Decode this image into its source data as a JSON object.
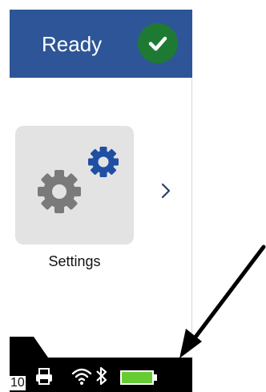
{
  "status": {
    "label": "Ready",
    "state_icon": "checkmark-icon",
    "bar_color": "#2e5597",
    "badge_color": "#1e7a33"
  },
  "menu": {
    "items": [
      {
        "label": "Settings",
        "icon": "gears-icon"
      }
    ],
    "next_icon": "chevron-right-icon"
  },
  "tray": {
    "count": "10",
    "icons": [
      "printer-icon",
      "wifi-icon",
      "bluetooth-icon",
      "battery-icon"
    ],
    "battery_color": "#66cc33"
  }
}
